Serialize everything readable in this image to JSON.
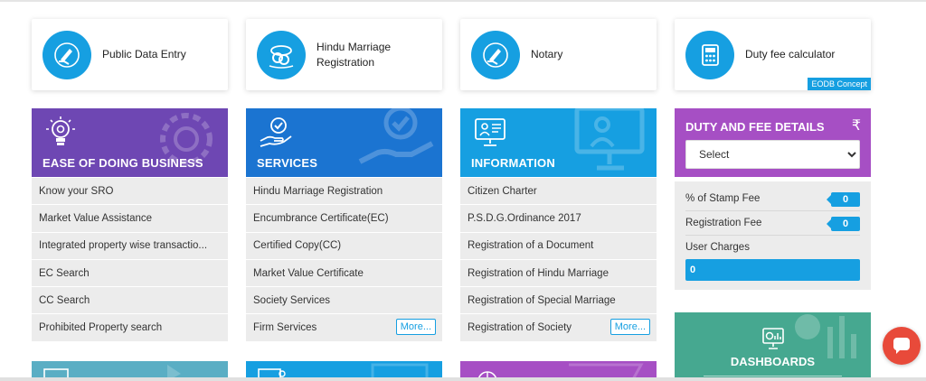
{
  "cards": [
    {
      "label": "Public Data Entry"
    },
    {
      "label": "Hindu Marriage Registration"
    },
    {
      "label": "Notary"
    },
    {
      "label": "Duty fee calculator",
      "badge": "EODB Concept"
    }
  ],
  "panels": {
    "ease": {
      "title": "EASE OF DOING BUSINESS",
      "items": [
        "Know your SRO",
        "Market Value Assistance",
        "Integrated property wise transactio...",
        "EC Search",
        "CC Search",
        "Prohibited Property search"
      ]
    },
    "services": {
      "title": "SERVICES",
      "items": [
        "Hindu Marriage Registration",
        "Encumbrance Certificate(EC)",
        "Certified Copy(CC)",
        "Market Value Certificate",
        "Society Services",
        "Firm Services"
      ],
      "more": "More..."
    },
    "information": {
      "title": "INFORMATION",
      "items": [
        "Citizen Charter",
        "P.S.D.G.Ordinance 2017",
        "Registration of a Document",
        "Registration of Hindu Marriage",
        "Registration of Special Marriage",
        "Registration of Society"
      ],
      "more": "More..."
    }
  },
  "duty": {
    "title": "DUTY AND FEE DETAILS",
    "currency": "₹",
    "select_value": "Select",
    "rows": [
      {
        "label": "% of Stamp Fee",
        "value": "0"
      },
      {
        "label": "Registration Fee",
        "value": "0"
      }
    ],
    "user_charges_label": "User Charges",
    "user_charges_value": "0"
  },
  "dashboards": {
    "title": "DASHBOARDS"
  },
  "colors": {
    "accent": "#169fe1",
    "purple": "#6e47b3",
    "blue": "#1b74d1",
    "magenta": "#a64fc4",
    "green": "#46a890",
    "teal": "#5aaec4",
    "chat": "#e84a3a"
  },
  "icons": [
    "edit-hand-icon",
    "wedding-rings-icon",
    "edit-hand-icon",
    "calculator-icon",
    "lightbulb-gear-icon",
    "hand-check-icon",
    "presentation-icon",
    "dashboard-monitor-icon",
    "chat-icon"
  ]
}
